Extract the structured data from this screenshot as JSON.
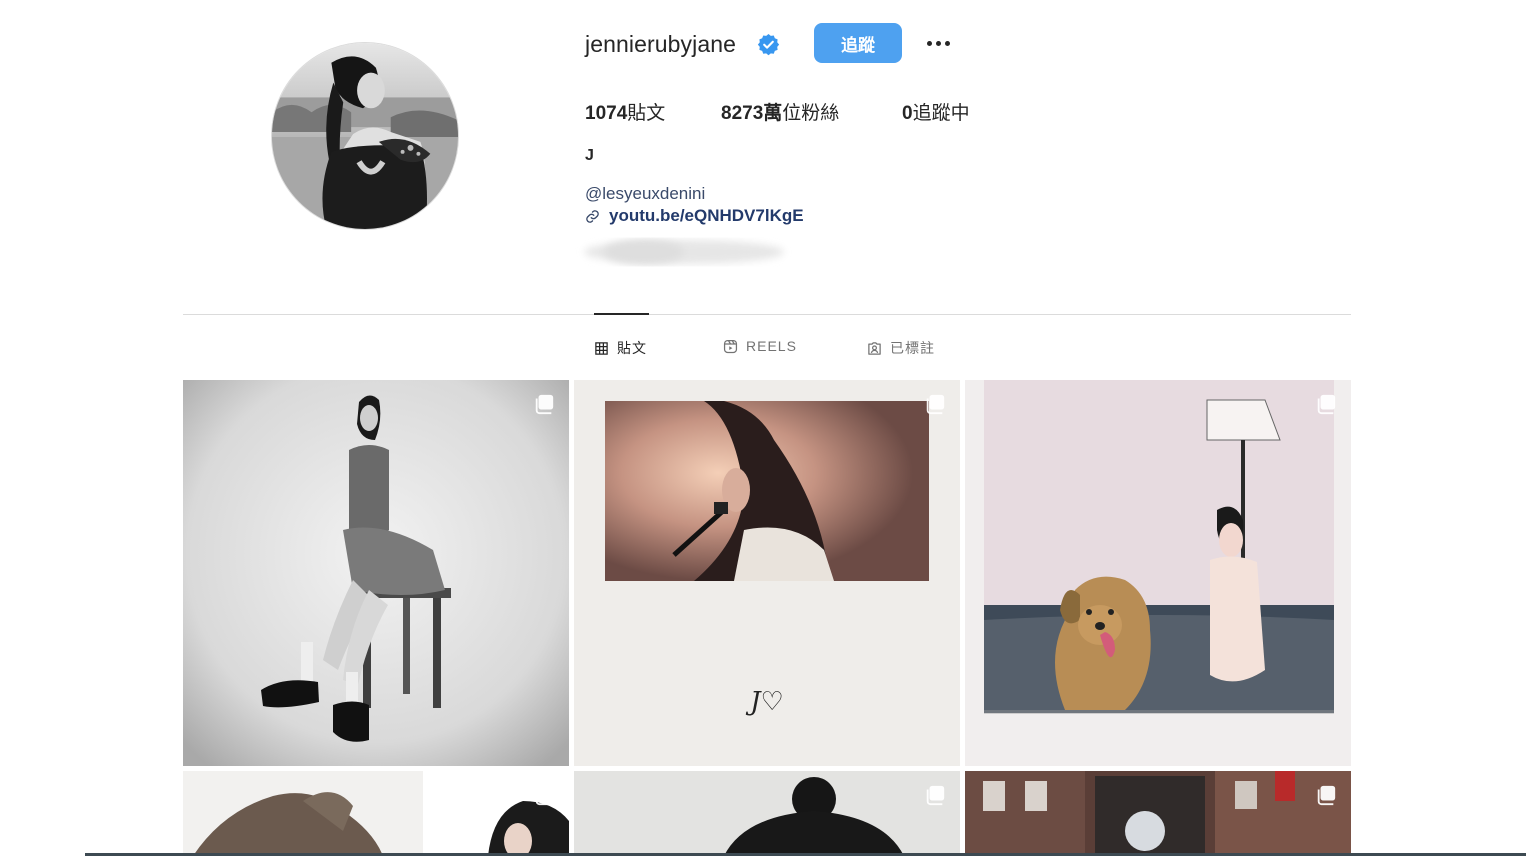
{
  "profile": {
    "username": "jennierubyjane",
    "verified": true,
    "follow_label": "追蹤",
    "more_label": "more-options",
    "stats": {
      "posts_value": "1074",
      "posts_label": "貼文",
      "followers_value": "8273萬",
      "followers_label": "位粉絲",
      "following_value": "0",
      "following_label": "追蹤中"
    },
    "bio": {
      "name": "J",
      "mention": "@lesyeuxdenini",
      "link": "youtu.be/eQNHDV7lKgE"
    }
  },
  "tabs": [
    {
      "label": "貼文",
      "icon": "grid-icon",
      "active": true
    },
    {
      "label": "REELS",
      "icon": "reels-icon",
      "active": false
    },
    {
      "label": "已標註",
      "icon": "tagged-icon",
      "active": false
    }
  ],
  "posts": [
    {
      "caption_text": "",
      "multi": true
    },
    {
      "caption_text": "J♡",
      "multi": true
    },
    {
      "caption_text": "",
      "multi": true
    },
    {
      "caption_text": "",
      "multi": true
    },
    {
      "caption_text": "",
      "multi": true
    },
    {
      "caption_text": "",
      "multi": true
    }
  ],
  "colors": {
    "follow_button": "#4ea1f0",
    "verified_badge": "#3897f0",
    "link": "#233a6b"
  }
}
